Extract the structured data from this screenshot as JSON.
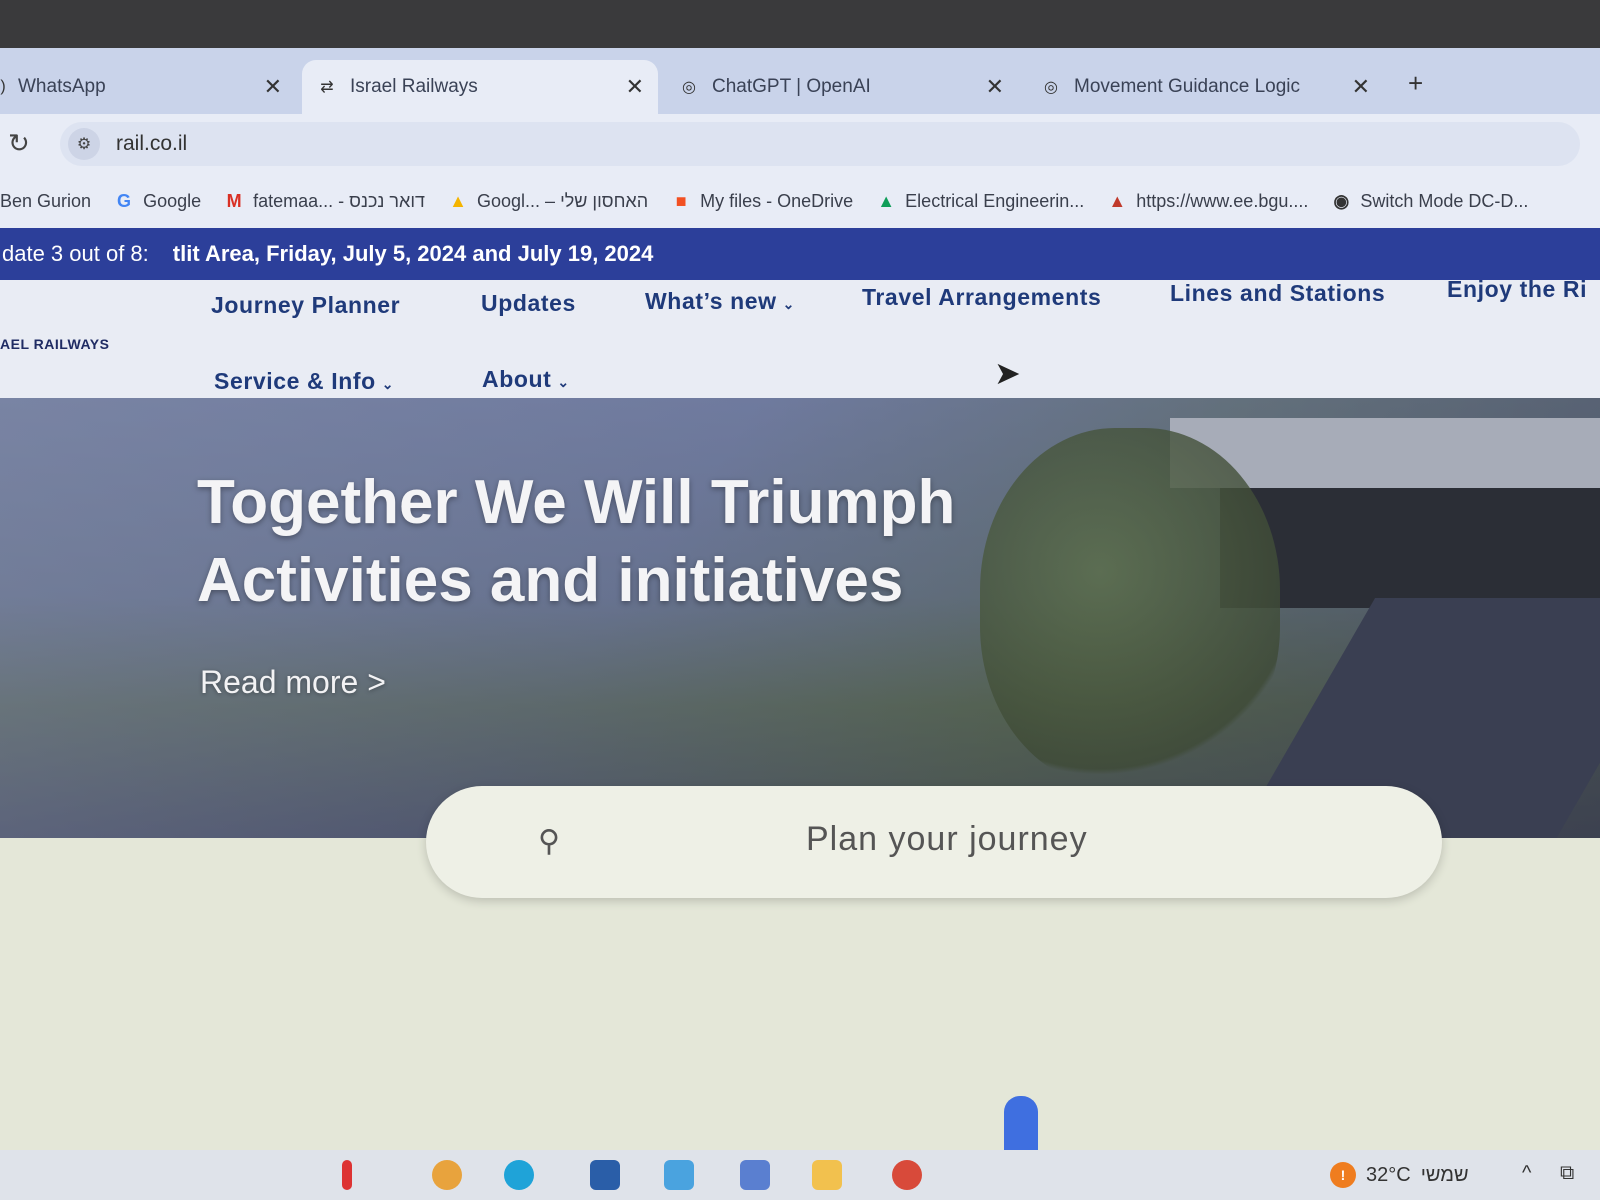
{
  "browser": {
    "tabs": [
      {
        "title": "WhatsApp",
        "icon": "whatsapp-icon",
        "active": false
      },
      {
        "title": "Israel Railways",
        "icon": "train-icon",
        "active": true
      },
      {
        "title": "ChatGPT | OpenAI",
        "icon": "openai-icon",
        "active": false
      },
      {
        "title": "Movement Guidance Logic",
        "icon": "openai-icon",
        "active": false
      }
    ],
    "close_glyph": "✕",
    "new_tab_glyph": "+",
    "reload_glyph": "↻",
    "site_info_glyph": "⚙",
    "url": "rail.co.il",
    "bookmarks": [
      {
        "label": "Ben Gurion",
        "icon": "none",
        "glyph": ""
      },
      {
        "label": "Google",
        "icon": "google-icon",
        "glyph": "G"
      },
      {
        "label": "fatemaa... - דואר נכנס",
        "icon": "gmail-icon",
        "glyph": "M"
      },
      {
        "label": "Googl... – האחסון שלי",
        "icon": "drive-icon",
        "glyph": "▲"
      },
      {
        "label": "My files - OneDrive",
        "icon": "microsoft-icon",
        "glyph": "■"
      },
      {
        "label": "Electrical Engineerin...",
        "icon": "drive-icon",
        "glyph": "▲"
      },
      {
        "label": "https://www.ee.bgu....",
        "icon": "pma-icon",
        "glyph": "▲"
      },
      {
        "label": "Switch Mode DC-D...",
        "icon": "openai-icon",
        "glyph": "◉"
      }
    ]
  },
  "site": {
    "announcement": {
      "prefix": "date 3 out of 8:",
      "text": "tlit Area, Friday, July 5, 2024 and July 19, 2024"
    },
    "logo_text": "AEL RAILWAYS",
    "nav": {
      "journey_planner": "Journey Planner",
      "updates": "Updates",
      "whats_new": "What’s new",
      "travel_arrangements": "Travel Arrangements",
      "lines_and_stations": "Lines and Stations",
      "enjoy": "Enjoy the Ri",
      "service_info": "Service & Info",
      "about": "About",
      "caret": "⌄"
    },
    "hero": {
      "title_line1": "Together We Will Triumph",
      "title_line2": "Activities and initiatives",
      "read_more": "Read more >"
    },
    "search": {
      "icon": "search-icon",
      "glyph": "⚲",
      "placeholder": "Plan your journey"
    }
  },
  "taskbar": {
    "weather_badge": "!",
    "temperature": "32°C",
    "weather_label": "שמשי",
    "tray_caret": "^",
    "tray_glyph": "⧉"
  },
  "colors": {
    "banner": "#2c3f9a",
    "nav_text": "#1f3a7a",
    "tab_strip": "#c9d3ea"
  }
}
